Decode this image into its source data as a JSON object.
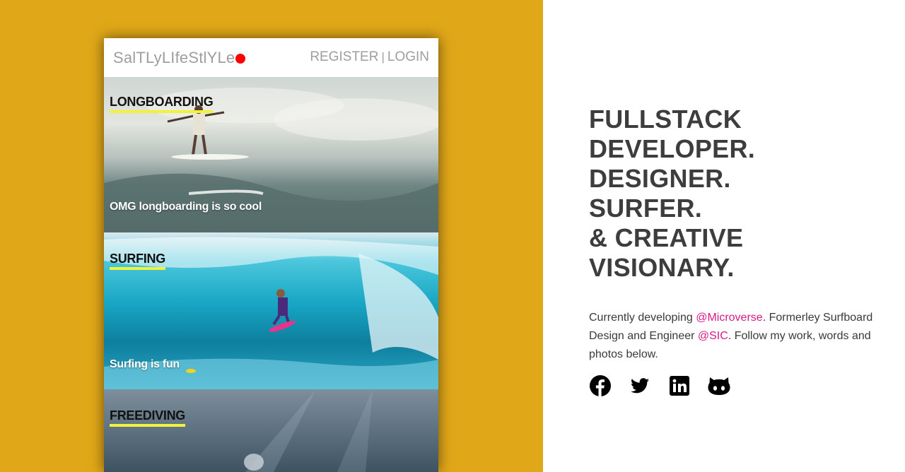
{
  "app": {
    "brand": "SalTLyLIfeStlYLe",
    "register_label": "REGISTER",
    "separator": "|",
    "login_label": "LOGIN"
  },
  "cards": [
    {
      "title": "LONGBOARDING",
      "caption": "OMG longboarding is so cool"
    },
    {
      "title": "SURFING",
      "caption": "Surfing is fun"
    },
    {
      "title": "FREEDIVING",
      "caption": ""
    }
  ],
  "profile": {
    "headline": [
      "FULLSTACK",
      "DEVELOPER.",
      "DESIGNER.",
      "SURFER.",
      "& CREATIVE",
      "VISIONARY."
    ],
    "bio": {
      "part1": "Currently developing ",
      "mention1": "@Microverse",
      "part2": ". Formerley Surfboard Design and Engineer ",
      "mention2": "@SIC",
      "part3": ". Follow my work, words and photos below."
    },
    "socials": [
      "facebook-icon",
      "twitter-icon",
      "linkedin-icon",
      "github-icon"
    ]
  },
  "colors": {
    "left_background": "#e0a718",
    "accent_mention": "#d8198a",
    "title_underline": "#f2f23a",
    "brand_dot": "#ff0000",
    "headline_text": "#3d3d3d"
  }
}
